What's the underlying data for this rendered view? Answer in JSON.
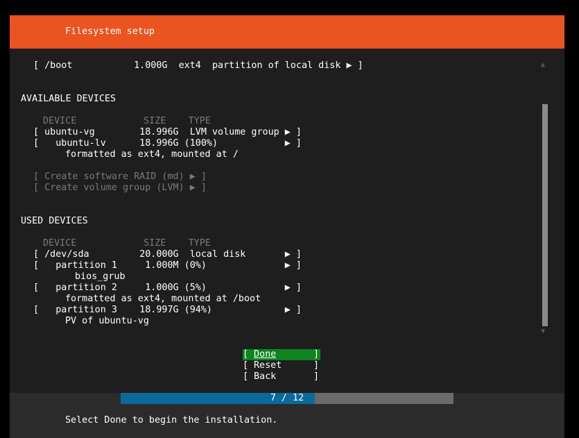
{
  "header": {
    "title": "Filesystem setup"
  },
  "boot_line": "[ /boot           1.000G  ext4  partition of local disk ▶ ]",
  "available": {
    "title": "AVAILABLE DEVICES",
    "column_header": "DEVICE            SIZE    TYPE",
    "rows": [
      "[ ubuntu-vg        18.996G  LVM volume group ▶ ]",
      "[   ubuntu-lv      18.996G (100%)            ▶ ]",
      "formatted as ext4, mounted at /"
    ],
    "actions": [
      "[ Create software RAID (md) ▶ ]",
      "[ Create volume group (LVM) ▶ ]"
    ]
  },
  "used": {
    "title": "USED DEVICES",
    "column_header": "DEVICE            SIZE    TYPE",
    "rows": [
      "[ /dev/sda         20.000G  local disk       ▶ ]",
      "[   partition 1     1.000M (0%)              ▶ ]",
      "bios_grub",
      "[   partition 2     1.000G (5%)              ▶ ]",
      "formatted as ext4, mounted at /boot",
      "[   partition 3    18.997G (94%)             ▶ ]",
      "PV of ubuntu-vg"
    ]
  },
  "buttons": {
    "done": "Done",
    "reset": "Reset",
    "back": "Back"
  },
  "progress": {
    "text": "7 / 12",
    "current": 7,
    "total": 12
  },
  "hint": "Select Done to begin the installation.",
  "colors": {
    "header": "#e95420",
    "focus": "#0e8420",
    "progress": "#0a6a9a"
  }
}
